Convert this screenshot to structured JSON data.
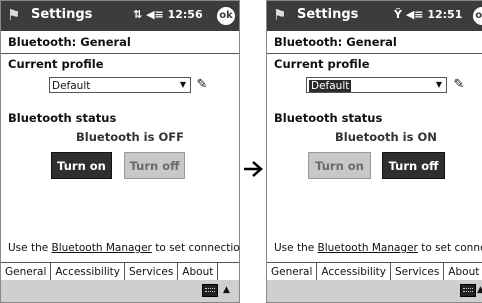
{
  "screens": [
    {
      "app_title": "Settings",
      "status": " 12:56",
      "ok_label": "ok",
      "page_header": "Bluetooth: General",
      "profile_label": "Current profile",
      "profile_value": "Default",
      "bt_status_label": "Bluetooth status",
      "bt_status_text": "Bluetooth is OFF",
      "turn_on_label": "Turn on",
      "turn_off_label": "Turn off",
      "footer_prefix": "Use the ",
      "footer_link": "Bluetooth Manager",
      "footer_suffix": " to set connections.",
      "tabs": [
        "General",
        "Accessibility",
        "Services",
        "About"
      ]
    },
    {
      "app_title": "Settings",
      "status": " 12:51",
      "ok_label": "ok",
      "page_header": "Bluetooth: General",
      "profile_label": "Current profile",
      "profile_value": "Default",
      "bt_status_label": "Bluetooth status",
      "bt_status_text": "Bluetooth is ON",
      "turn_on_label": "Turn on",
      "turn_off_label": "Turn off",
      "footer_prefix": "Use the ",
      "footer_link": "Bluetooth Manager",
      "footer_suffix": " to set connections.",
      "tabs": [
        "General",
        "Accessibility",
        "Services",
        "About"
      ]
    }
  ],
  "icons": {
    "start": "windows-flag-icon",
    "signal": "signal-icon",
    "volume": "speaker-icon",
    "profile": "profile-settings-icon",
    "keyboard": "keyboard-icon",
    "arrow": "right-arrow-icon"
  },
  "colors": {
    "titlebar": "#3c3c3c",
    "button_active": "#2f2f2f",
    "button_inactive": "#c8c8c8",
    "bottom_bar": "#cfcfcf"
  }
}
